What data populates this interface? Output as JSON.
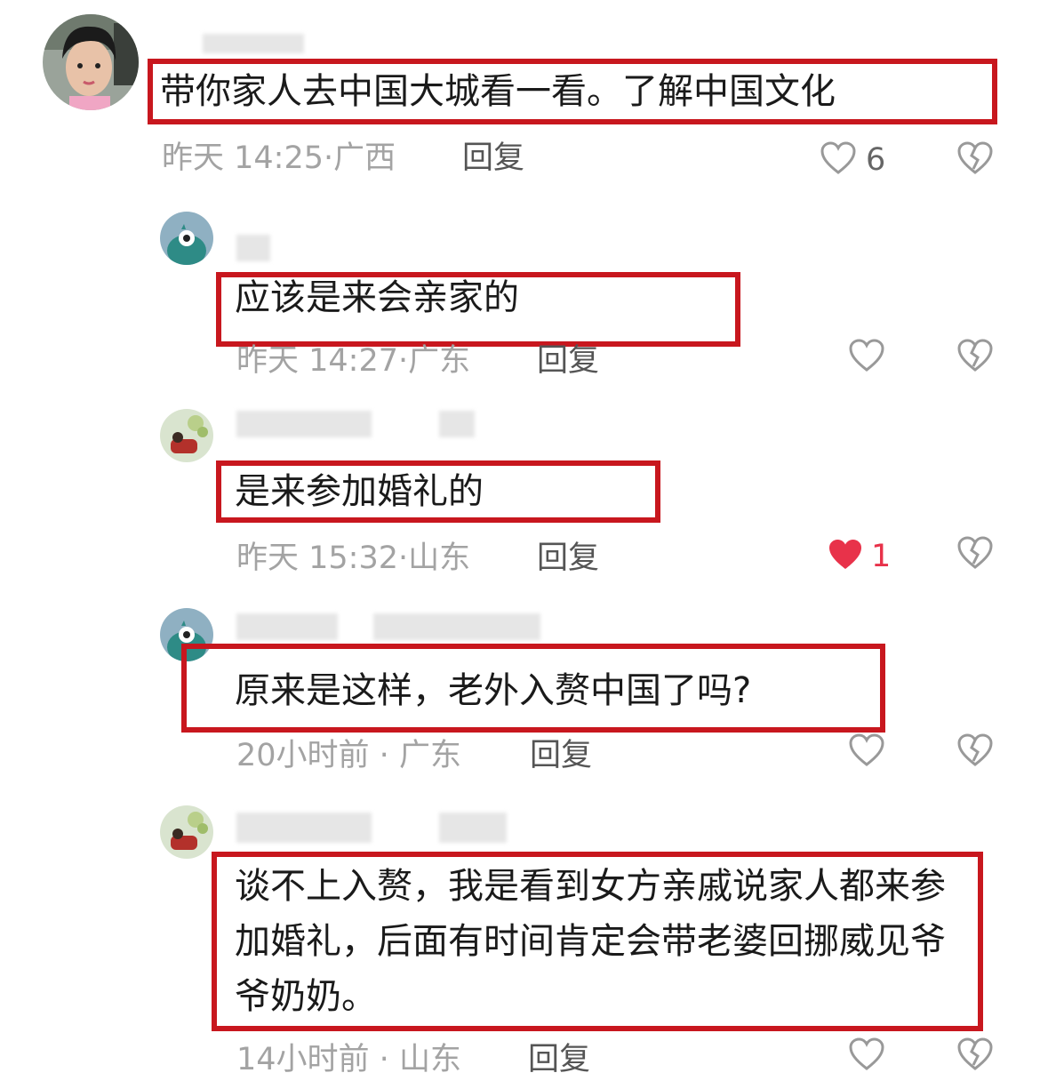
{
  "comments": [
    {
      "text": "带你家人去中国大城看一看。了解中国文化",
      "time": "昨天 14:25",
      "location": "广西",
      "reply_label": "回复",
      "like_count": "6",
      "liked": false
    },
    {
      "text": "应该是来会亲家的",
      "time": "昨天 14:27",
      "location": "广东",
      "reply_label": "回复",
      "like_count": "",
      "liked": false
    },
    {
      "text": "是来参加婚礼的",
      "time": "昨天 15:32",
      "location": "山东",
      "reply_label": "回复",
      "like_count": "1",
      "liked": true
    },
    {
      "text": "原来是这样，老外入赘中国了吗?",
      "time": "20小时前",
      "location": "广东",
      "reply_label": "回复",
      "like_count": "",
      "liked": false
    },
    {
      "text": "谈不上入赘，我是看到女方亲戚说家人都来参加婚礼，后面有时间肯定会带老婆回挪威见爷爷奶奶。",
      "time": "14小时前",
      "location": "山东",
      "reply_label": "回复",
      "like_count": "",
      "liked": false
    }
  ],
  "colors": {
    "highlight_box": "#c8171e",
    "liked_heart": "#e8324a",
    "meta_text": "#a3a3a3"
  },
  "icons": {
    "like": "heart-outline-icon",
    "liked": "heart-filled-icon",
    "dislike": "broken-heart-icon"
  }
}
